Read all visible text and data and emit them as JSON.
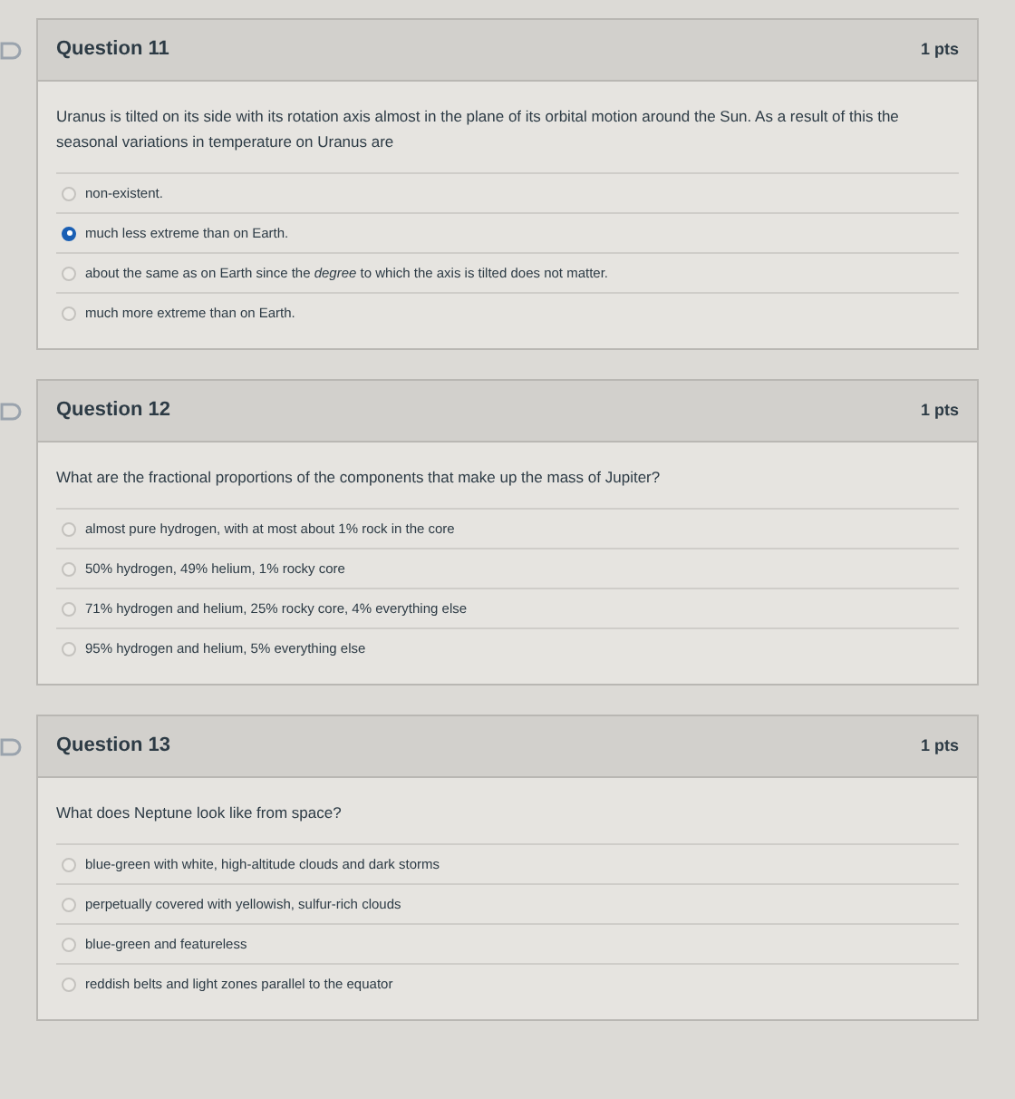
{
  "questions": [
    {
      "title": "Question 11",
      "points": "1 pts",
      "text": "Uranus is tilted on its side with its rotation axis almost in the plane of its orbital motion around the Sun. As a result of this the seasonal variations in temperature on Uranus are",
      "answers": [
        {
          "label": "non-existent.",
          "selected": false
        },
        {
          "label": "much less extreme than on Earth.",
          "selected": true
        },
        {
          "label": "about the same as on Earth since the *degree* to which the axis is tilted does not matter.",
          "selected": false
        },
        {
          "label": "much more extreme than on Earth.",
          "selected": false
        }
      ]
    },
    {
      "title": "Question 12",
      "points": "1 pts",
      "text": "What are the fractional proportions of the components that make up the mass of Jupiter?",
      "answers": [
        {
          "label": "almost pure hydrogen, with at most about 1% rock in the core",
          "selected": false
        },
        {
          "label": "50% hydrogen, 49% helium, 1% rocky core",
          "selected": false
        },
        {
          "label": "71% hydrogen and helium, 25% rocky core, 4% everything else",
          "selected": false
        },
        {
          "label": "95% hydrogen and helium, 5% everything else",
          "selected": false
        }
      ]
    },
    {
      "title": "Question 13",
      "points": "1 pts",
      "text": "What does Neptune look like from space?",
      "answers": [
        {
          "label": "blue-green with white, high-altitude clouds and dark storms",
          "selected": false
        },
        {
          "label": "perpetually covered with yellowish, sulfur-rich clouds",
          "selected": false
        },
        {
          "label": "blue-green and featureless",
          "selected": false
        },
        {
          "label": "reddish belts and light zones parallel to the equator",
          "selected": false
        }
      ]
    }
  ]
}
